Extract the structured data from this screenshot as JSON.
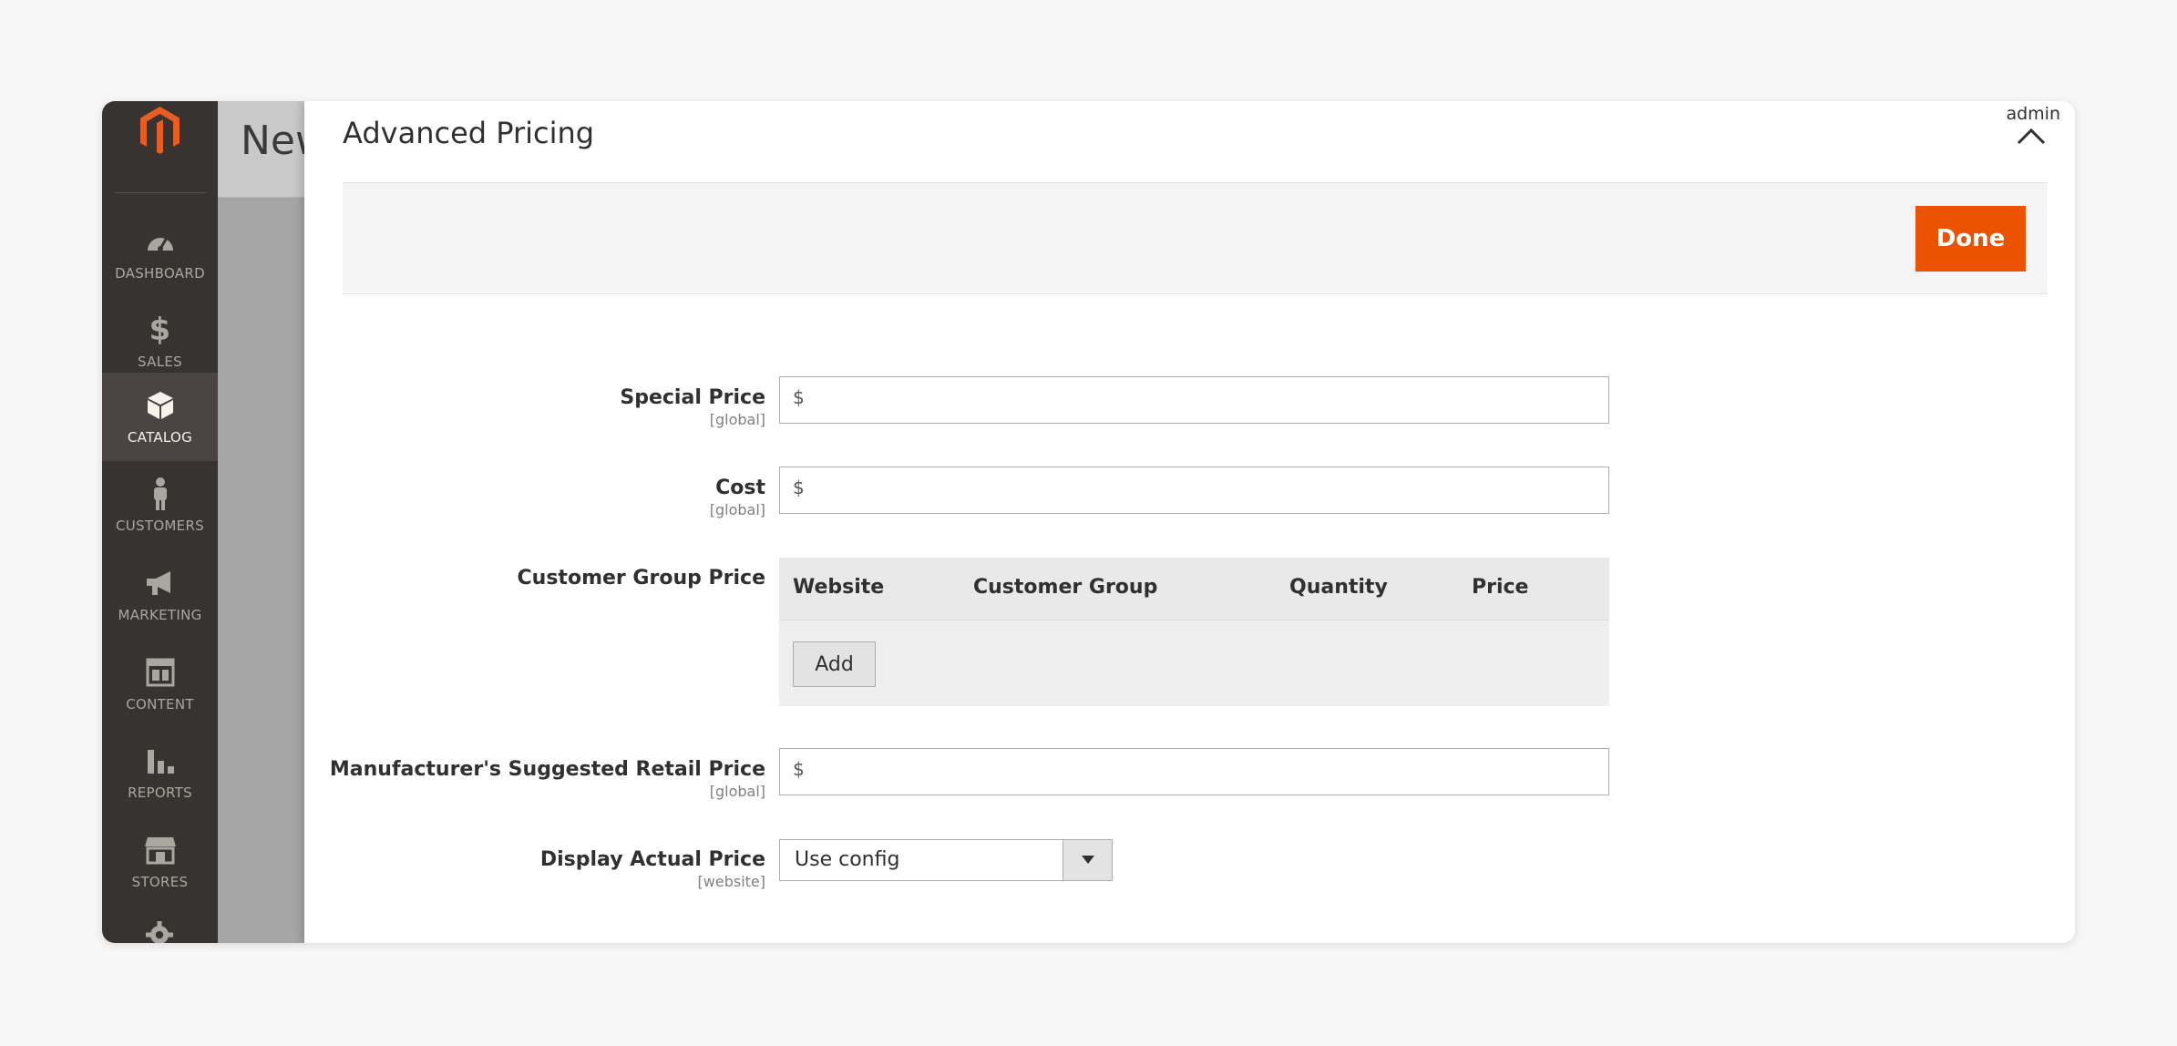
{
  "sidebar": {
    "items": [
      {
        "label": "DASHBOARD",
        "icon": "dashboard-icon",
        "active": false
      },
      {
        "label": "SALES",
        "icon": "dollar-icon",
        "active": false
      },
      {
        "label": "CATALOG",
        "icon": "box-icon",
        "active": true
      },
      {
        "label": "CUSTOMERS",
        "icon": "person-icon",
        "active": false
      },
      {
        "label": "MARKETING",
        "icon": "megaphone-icon",
        "active": false
      },
      {
        "label": "CONTENT",
        "icon": "layout-icon",
        "active": false
      },
      {
        "label": "REPORTS",
        "icon": "bar-chart-icon",
        "active": false
      },
      {
        "label": "STORES",
        "icon": "store-icon",
        "active": false
      }
    ],
    "logo": "magento-logo"
  },
  "background_page": {
    "title": "New"
  },
  "modal": {
    "title": "Advanced Pricing",
    "admin_label": "admin",
    "done_label": "Done",
    "fields": {
      "special_price": {
        "label": "Special Price",
        "scope": "[global]",
        "addon": "$",
        "value": ""
      },
      "cost": {
        "label": "Cost",
        "scope": "[global]",
        "addon": "$",
        "value": ""
      },
      "customer_group_price": {
        "label": "Customer Group Price",
        "columns": [
          "Website",
          "Customer Group",
          "Quantity",
          "Price"
        ],
        "add_label": "Add"
      },
      "msrp": {
        "label": "Manufacturer's Suggested Retail Price",
        "scope": "[global]",
        "addon": "$",
        "value": ""
      },
      "display_actual_price": {
        "label": "Display Actual Price",
        "scope": "[website]",
        "selected": "Use config"
      }
    }
  },
  "colors": {
    "accent": "#eb5202",
    "sidebar_bg": "#373330",
    "logo": "#e85d22"
  }
}
